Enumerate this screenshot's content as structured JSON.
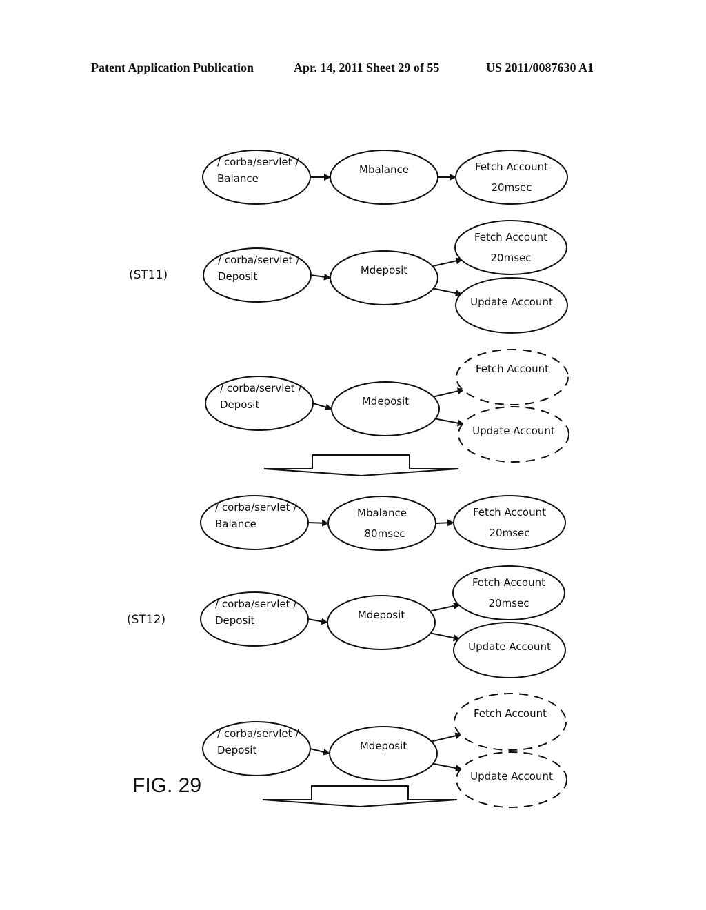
{
  "header": {
    "left": "Patent Application Publication",
    "middle": "Apr. 14, 2011  Sheet 29 of 55",
    "right": "US 2011/0087630 A1"
  },
  "figure_label": "FIG. 29",
  "steps": [
    {
      "id": "ST11",
      "label": "(ST11)"
    },
    {
      "id": "ST12",
      "label": "(ST12)"
    }
  ],
  "groups": [
    {
      "id": "g1",
      "step": "ST11",
      "nodes": [
        {
          "id": "servlet",
          "lines": [
            "/ corba/servlet /",
            "Balance"
          ],
          "style": "solid"
        },
        {
          "id": "method",
          "lines": [
            "Mbalance"
          ],
          "style": "solid"
        },
        {
          "id": "fetch",
          "lines": [
            "Fetch Account",
            "20msec"
          ],
          "style": "solid"
        }
      ],
      "edges": [
        [
          "servlet",
          "method"
        ],
        [
          "method",
          "fetch"
        ]
      ]
    },
    {
      "id": "g2",
      "step": "ST11",
      "nodes": [
        {
          "id": "servlet",
          "lines": [
            "/ corba/servlet /",
            "Deposit"
          ],
          "style": "solid"
        },
        {
          "id": "method",
          "lines": [
            "Mdeposit"
          ],
          "style": "solid"
        },
        {
          "id": "fetch",
          "lines": [
            "Fetch Account",
            "20msec"
          ],
          "style": "solid"
        },
        {
          "id": "update",
          "lines": [
            "Update Account"
          ],
          "style": "solid"
        }
      ],
      "edges": [
        [
          "servlet",
          "method"
        ],
        [
          "method",
          "fetch"
        ],
        [
          "method",
          "update"
        ]
      ]
    },
    {
      "id": "g3",
      "step": "ST11",
      "nodes": [
        {
          "id": "servlet",
          "lines": [
            "/ corba/servlet /",
            "Deposit"
          ],
          "style": "solid"
        },
        {
          "id": "method",
          "lines": [
            "Mdeposit"
          ],
          "style": "solid"
        },
        {
          "id": "fetch",
          "lines": [
            "Fetch Account"
          ],
          "style": "dashed"
        },
        {
          "id": "update",
          "lines": [
            "Update Account"
          ],
          "style": "dashed"
        }
      ],
      "edges": [
        [
          "servlet",
          "method"
        ],
        [
          "method",
          "fetch"
        ],
        [
          "method",
          "update"
        ]
      ]
    },
    {
      "id": "g4",
      "step": "ST12",
      "nodes": [
        {
          "id": "servlet",
          "lines": [
            "/ corba/servlet /",
            "Balance"
          ],
          "style": "solid"
        },
        {
          "id": "method",
          "lines": [
            "Mbalance",
            "80msec"
          ],
          "style": "solid"
        },
        {
          "id": "fetch",
          "lines": [
            "Fetch Account",
            "20msec"
          ],
          "style": "solid"
        }
      ],
      "edges": [
        [
          "servlet",
          "method"
        ],
        [
          "method",
          "fetch"
        ]
      ]
    },
    {
      "id": "g5",
      "step": "ST12",
      "nodes": [
        {
          "id": "servlet",
          "lines": [
            "/ corba/servlet /",
            "Deposit"
          ],
          "style": "solid"
        },
        {
          "id": "method",
          "lines": [
            "Mdeposit"
          ],
          "style": "solid"
        },
        {
          "id": "fetch",
          "lines": [
            "Fetch Account",
            "20msec"
          ],
          "style": "solid"
        },
        {
          "id": "update",
          "lines": [
            "Update Account"
          ],
          "style": "solid"
        }
      ],
      "edges": [
        [
          "servlet",
          "method"
        ],
        [
          "method",
          "fetch"
        ],
        [
          "method",
          "update"
        ]
      ]
    },
    {
      "id": "g6",
      "step": "ST12",
      "nodes": [
        {
          "id": "servlet",
          "lines": [
            "/ corba/servlet /",
            "Deposit"
          ],
          "style": "solid"
        },
        {
          "id": "method",
          "lines": [
            "Mdeposit"
          ],
          "style": "solid"
        },
        {
          "id": "fetch",
          "lines": [
            "Fetch Account"
          ],
          "style": "dashed"
        },
        {
          "id": "update",
          "lines": [
            "Update Account"
          ],
          "style": "dashed"
        }
      ],
      "edges": [
        [
          "servlet",
          "method"
        ],
        [
          "method",
          "fetch"
        ],
        [
          "method",
          "update"
        ]
      ]
    }
  ],
  "transitions": [
    {
      "id": "t1",
      "direction": "down"
    },
    {
      "id": "t2",
      "direction": "down"
    }
  ]
}
